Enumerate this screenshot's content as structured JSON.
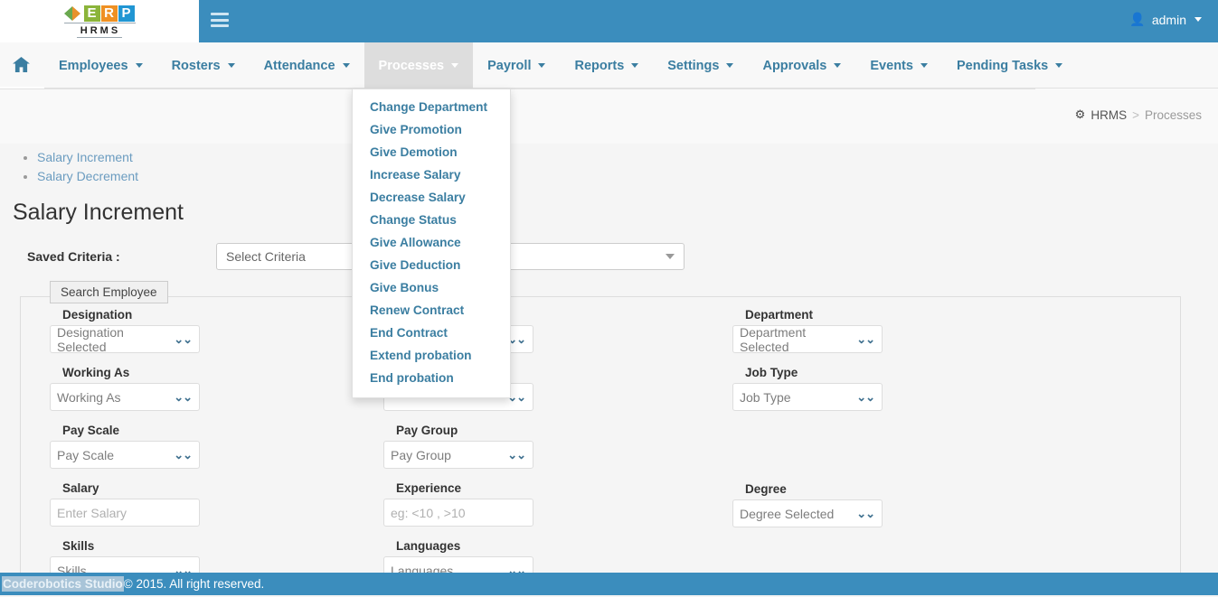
{
  "brand": {
    "logo_letters": [
      "E",
      "R",
      "P"
    ],
    "logo_subtitle": "HRMS",
    "accent_blue": "#3b8dbd",
    "link_blue": "#3b7ea1"
  },
  "topbar": {
    "menu_toggle": "hamburger-icon",
    "user": {
      "name": "admin",
      "icon": "user-icon"
    }
  },
  "navbar": {
    "home_icon": "home-icon",
    "items": [
      {
        "label": "Employees",
        "active": false
      },
      {
        "label": "Rosters",
        "active": false
      },
      {
        "label": "Attendance",
        "active": false
      },
      {
        "label": "Processes",
        "active": true
      },
      {
        "label": "Payroll",
        "active": false
      },
      {
        "label": "Reports",
        "active": false
      },
      {
        "label": "Settings",
        "active": false
      },
      {
        "label": "Approvals",
        "active": false
      },
      {
        "label": "Events",
        "active": false
      },
      {
        "label": "Pending Tasks",
        "active": false
      }
    ]
  },
  "dropdown": {
    "open_for": "Processes",
    "items": [
      "Change Department",
      "Give Promotion",
      "Give Demotion",
      "Increase Salary",
      "Decrease Salary",
      "Change Status",
      "Give Allowance",
      "Give Deduction",
      "Give Bonus",
      "Renew Contract",
      "End Contract",
      "Extend probation",
      "End probation"
    ]
  },
  "breadcrumb": {
    "icon": "dashboard-icon",
    "root": "HRMS",
    "separator": ">",
    "current": "Processes"
  },
  "quicklinks": [
    "Salary Increment",
    "Salary Decrement"
  ],
  "main": {
    "page_title": "Salary Increment",
    "saved_criteria_label": "Saved Criteria :",
    "saved_criteria_value": "Select Criteria",
    "panel_legend": "Search Employee",
    "columns": [
      {
        "fields": [
          {
            "label": "Designation",
            "value": "Designation Selected",
            "control": "select",
            "tight": true
          },
          {
            "label": "Working As",
            "value": "Working As",
            "control": "select",
            "tight": false
          },
          {
            "label": "Pay Scale",
            "value": "Pay Scale",
            "control": "select",
            "tight": false
          },
          {
            "label": "Salary",
            "value": "Enter Salary",
            "control": "input",
            "tight": false
          },
          {
            "label": "Skills",
            "value": "Skills",
            "control": "select",
            "tight": false
          }
        ]
      },
      {
        "fields": [
          {
            "label": "",
            "value": "",
            "control": "select",
            "tight": false
          },
          {
            "label": "",
            "value": "",
            "control": "select",
            "tight": false
          },
          {
            "label": "Pay Group",
            "value": "Pay Group",
            "control": "select",
            "tight": false
          },
          {
            "label": "Experience",
            "value": "eg: <10 , >10",
            "control": "input",
            "tight": false
          },
          {
            "label": "Languages",
            "value": "Languages",
            "control": "select",
            "tight": false
          }
        ]
      },
      {
        "fields": [
          {
            "label": "Department",
            "value": "Department Selected",
            "control": "select",
            "tight": true
          },
          {
            "label": "Job Type",
            "value": "Job Type",
            "control": "select",
            "tight": false
          },
          {
            "label": "",
            "value": "",
            "control": "spacer",
            "tight": false
          },
          {
            "label": "Degree",
            "value": "Degree Selected",
            "control": "select",
            "tight": false
          },
          {
            "label": "",
            "value": "",
            "control": "spacer",
            "tight": false
          }
        ]
      }
    ]
  },
  "footer": {
    "brand": "Coderobotics Studio",
    "text": " © 2015. All right reserved."
  }
}
